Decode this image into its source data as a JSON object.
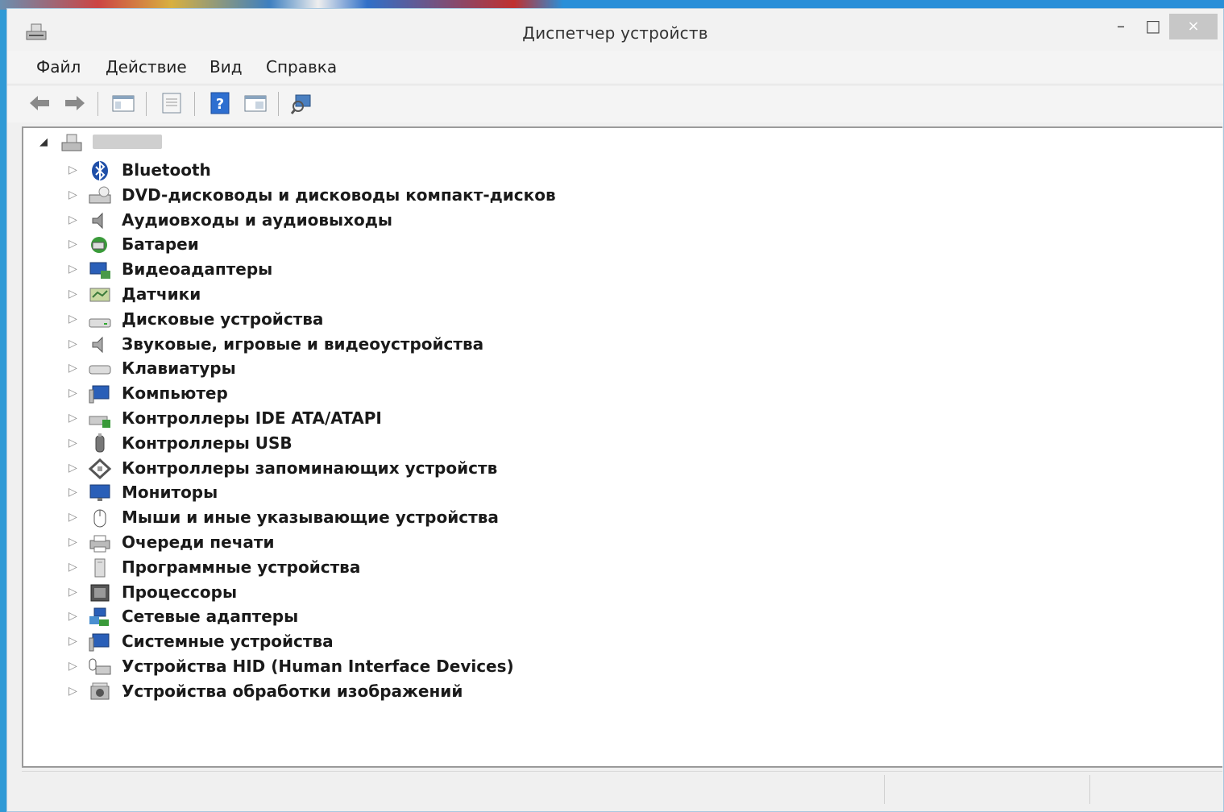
{
  "window": {
    "title": "Диспетчер устройств",
    "minimize_glyph": "–",
    "maximize_glyph": "□",
    "close_glyph": "×"
  },
  "menu": {
    "items": [
      "Файл",
      "Действие",
      "Вид",
      "Справка"
    ]
  },
  "toolbar": {
    "buttons": [
      "back-arrow-icon",
      "forward-arrow-icon",
      "show-hide-console-tree-icon",
      "properties-icon",
      "help-icon",
      "view-icon",
      "scan-hardware-icon"
    ]
  },
  "tree": {
    "root_expanded": true,
    "categories": [
      {
        "label": "Bluetooth",
        "icon": "bluetooth-icon"
      },
      {
        "label": "DVD-дисководы и дисководы компакт-дисков",
        "icon": "dvd-drive-icon"
      },
      {
        "label": "Аудиовходы и аудиовыходы",
        "icon": "audio-io-icon"
      },
      {
        "label": "Батареи",
        "icon": "battery-icon"
      },
      {
        "label": "Видеоадаптеры",
        "icon": "display-adapter-icon"
      },
      {
        "label": "Датчики",
        "icon": "sensor-icon"
      },
      {
        "label": "Дисковые устройства",
        "icon": "disk-drive-icon"
      },
      {
        "label": "Звуковые, игровые и видеоустройства",
        "icon": "sound-icon"
      },
      {
        "label": "Клавиатуры",
        "icon": "keyboard-icon"
      },
      {
        "label": "Компьютер",
        "icon": "computer-icon"
      },
      {
        "label": "Контроллеры IDE ATA/ATAPI",
        "icon": "ide-controller-icon"
      },
      {
        "label": "Контроллеры USB",
        "icon": "usb-icon"
      },
      {
        "label": "Контроллеры запоминающих устройств",
        "icon": "storage-controller-icon"
      },
      {
        "label": "Мониторы",
        "icon": "monitor-icon"
      },
      {
        "label": "Мыши и иные указывающие устройства",
        "icon": "mouse-icon"
      },
      {
        "label": "Очереди печати",
        "icon": "printer-icon"
      },
      {
        "label": "Программные устройства",
        "icon": "software-device-icon"
      },
      {
        "label": "Процессоры",
        "icon": "processor-icon"
      },
      {
        "label": "Сетевые адаптеры",
        "icon": "network-adapter-icon"
      },
      {
        "label": "Системные устройства",
        "icon": "system-device-icon"
      },
      {
        "label": "Устройства HID (Human Interface Devices)",
        "icon": "hid-icon"
      },
      {
        "label": "Устройства обработки изображений",
        "icon": "imaging-device-icon"
      }
    ]
  },
  "colors": {
    "accent": "#2f9ad6",
    "close_button": "#c7c7c7",
    "window_bg": "#f0f0f0"
  }
}
